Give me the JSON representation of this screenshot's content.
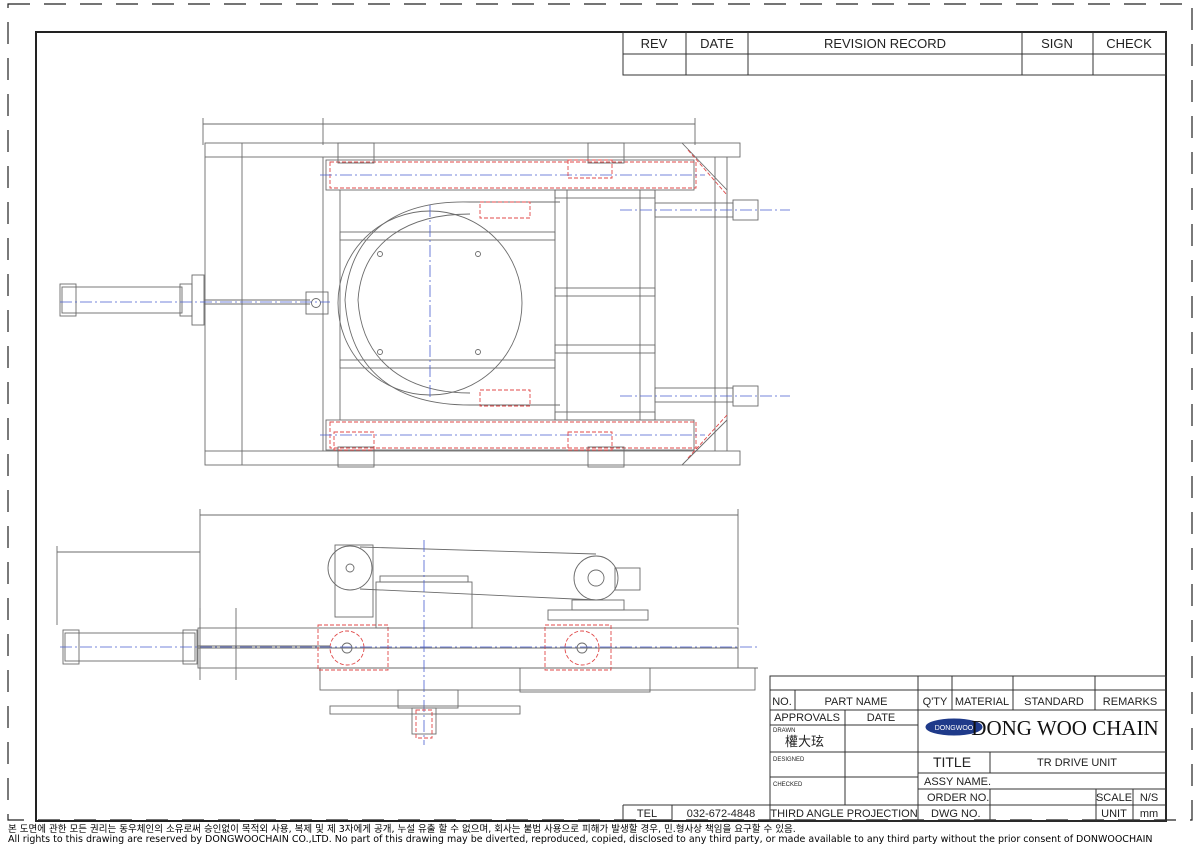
{
  "revision_block": {
    "headers": [
      "REV",
      "DATE",
      "REVISION RECORD",
      "SIGN",
      "CHECK"
    ]
  },
  "parts_list": {
    "headers": [
      "NO.",
      "PART NAME",
      "Q'TY",
      "MATERIAL",
      "STANDARD",
      "REMARKS"
    ]
  },
  "title_block": {
    "approvals_label": "APPROVALS",
    "date_label": "DATE",
    "drawn_label": "DRAWN",
    "drawn_by": "權大玹",
    "designed_label": "DESIGNED",
    "checked_label": "CHECKED",
    "logo_text": "DONGWOO",
    "company_name": "DONG WOO CHAIN",
    "title_label": "TITLE",
    "title_value": "TR DRIVE UNIT",
    "assy_name_label": "ASSY NAME.",
    "order_no_label": "ORDER NO.",
    "dwg_no_label": "DWG NO.",
    "scale_label": "SCALE",
    "scale_value": "N/S",
    "unit_label": "UNIT",
    "unit_value": "mm",
    "tel_label": "TEL",
    "tel_value": "032-672-4848",
    "projection": "THIRD ANGLE PROJECTION"
  },
  "footer": {
    "korean_notice": "본 도면에 관한 모든 권리는 동우체인의 소유로써 승인없이 목적외 사용, 복제 및 제 3자에게 공개, 누설 유출 할 수 없으며, 회사는 불법 사용으로 피해가 발생할 경우, 민.형사상 책임을 요구할 수 있음.",
    "english_notice": "All rights to this drawing are reserved by DONGWOOCHAIN CO.,LTD. No part of this drawing may be diverted, reproduced, copied, disclosed to any third party, or made available to any third party without the prior consent of DONWOOCHAIN"
  },
  "colors": {
    "hidden_line": "#e04848",
    "center_line": "#4a5fd0",
    "outline": "#333333",
    "logo_fill": "#1f3a8a"
  }
}
